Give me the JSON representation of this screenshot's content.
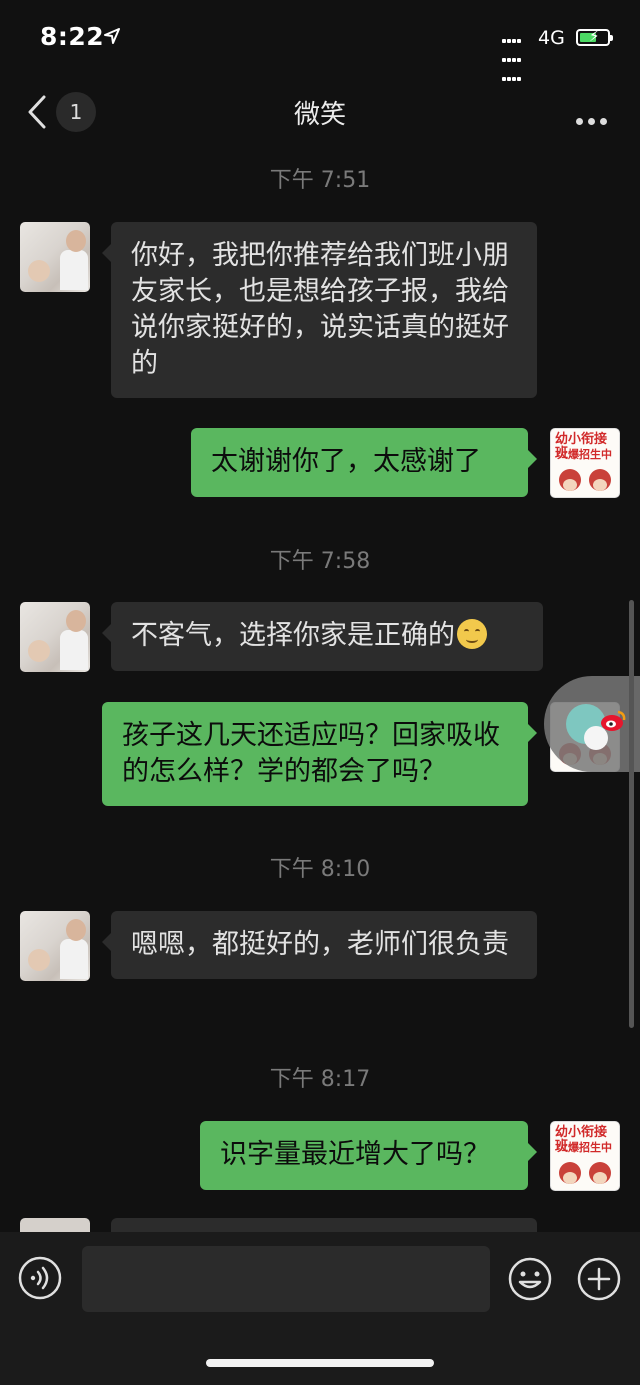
{
  "status_bar": {
    "time": "8:22",
    "network": "4G"
  },
  "nav": {
    "back_badge": "1",
    "title": "微笑"
  },
  "messages": [
    {
      "type": "time",
      "text": "下午 7:51"
    },
    {
      "type": "in",
      "text": "你好，我把你推荐给我们班小朋友家长，也是想给孩子报，我给说你家挺好的，说实话真的挺好的"
    },
    {
      "type": "out",
      "text": "太谢谢你了，太感谢了"
    },
    {
      "type": "time",
      "text": "下午 7:58"
    },
    {
      "type": "in",
      "text": "不客气，选择你家是正确的"
    },
    {
      "type": "out",
      "text": "孩子这几天还适应吗？回家吸收的怎么样？学的都会了吗？"
    },
    {
      "type": "time",
      "text": "下午 8:10"
    },
    {
      "type": "in",
      "text": "嗯嗯，都挺好的，老师们很负责"
    },
    {
      "type": "time",
      "text": "下午 8:17"
    },
    {
      "type": "out",
      "text": "识字量最近增大了吗？"
    }
  ],
  "right_avatar": {
    "line1": "幼小衔接班",
    "line2": "火爆招生中"
  },
  "input": {
    "placeholder": ""
  },
  "colors": {
    "outgoing_bubble": "#5ab75f",
    "incoming_bubble": "#2c2c2c",
    "background": "#111111"
  }
}
